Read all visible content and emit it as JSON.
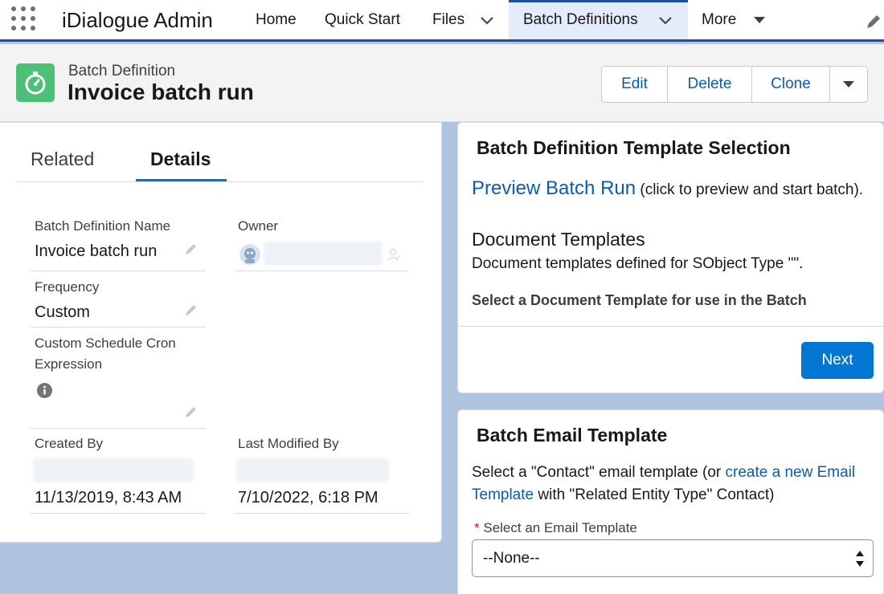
{
  "nav": {
    "app_name": "iDialogue Admin",
    "items": [
      {
        "label": "Home"
      },
      {
        "label": "Quick Start"
      },
      {
        "label": "Files"
      },
      {
        "label": "Batch Definitions"
      },
      {
        "label": "More"
      }
    ]
  },
  "record": {
    "type_label": "Batch Definition",
    "title": "Invoice batch run",
    "actions": {
      "edit": "Edit",
      "delete": "Delete",
      "clone": "Clone"
    }
  },
  "details": {
    "tabs": {
      "related": "Related",
      "details": "Details"
    },
    "fields": {
      "name_label": "Batch Definition Name",
      "name_value": "Invoice batch run",
      "owner_label": "Owner",
      "frequency_label": "Frequency",
      "frequency_value": "Custom",
      "cron_label_line1": "Custom Schedule Cron",
      "cron_label_line2": "Expression",
      "created_by_label": "Created By",
      "created_date": "11/13/2019, 8:43 AM",
      "modified_by_label": "Last Modified By",
      "modified_date": "7/10/2022, 6:18 PM"
    }
  },
  "template_selection": {
    "title": "Batch Definition Template Selection",
    "preview_link": "Preview Batch Run",
    "preview_note": " (click to preview and start batch).",
    "doc_heading": "Document Templates",
    "doc_desc": "Document templates defined for SObject Type \"\".",
    "select_prompt": "Select a Document Template for use in the Batch",
    "next_label": "Next"
  },
  "email_template": {
    "title": "Batch Email Template",
    "desc_prefix": "Select a \"Contact\" email template (or ",
    "create_link_line1": "create a new Email",
    "create_link_line2": "Template",
    "desc_suffix": " with \"Related Entity Type\" Contact)",
    "required_mark": "*",
    "select_label": "Select an Email Template",
    "select_value": "--None--"
  },
  "colors": {
    "brand_blue": "#0176d3",
    "link_blue": "#0b5cab",
    "nav_accent": "#1b5297",
    "record_icon_green": "#4bc076",
    "page_background": "#b0c4df"
  }
}
